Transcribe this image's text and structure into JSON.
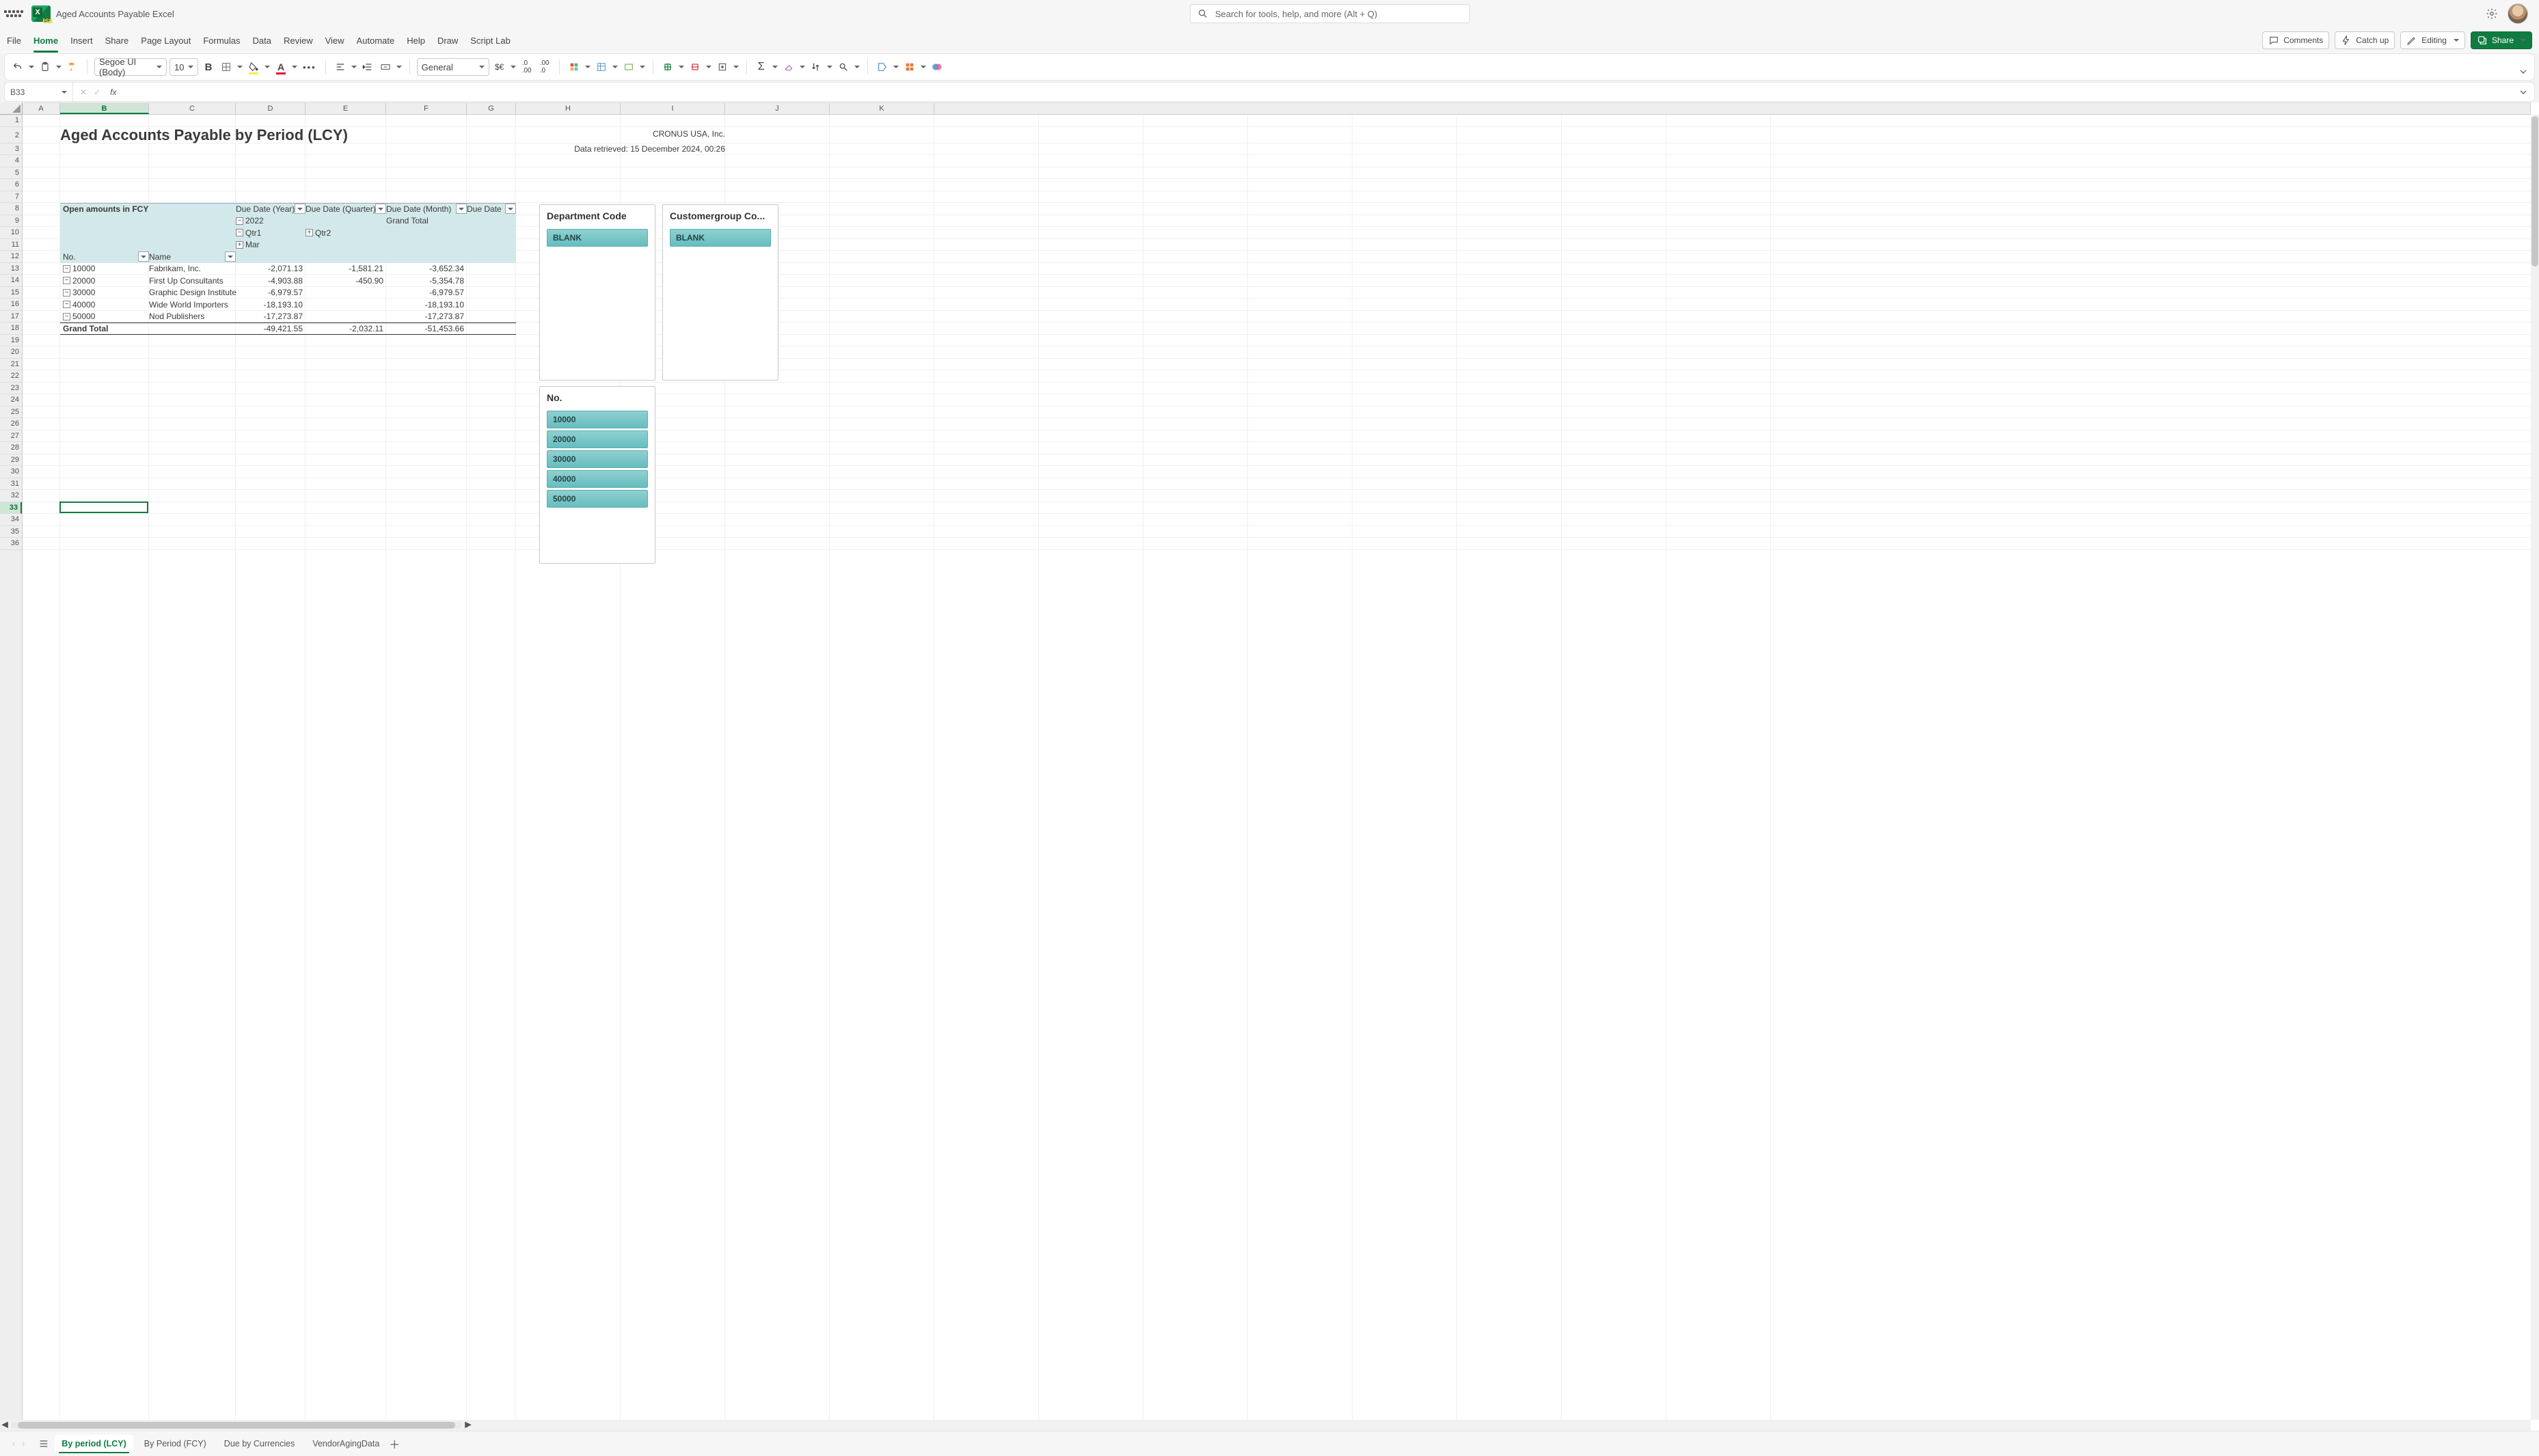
{
  "colors": {
    "accent": "#107c41",
    "slicer": "#7fcacc"
  },
  "title_bar": {
    "doc_title": "Aged Accounts Payable Excel",
    "search_placeholder": "Search for tools, help, and more (Alt + Q)"
  },
  "menu": {
    "tabs": [
      "File",
      "Home",
      "Insert",
      "Share",
      "Page Layout",
      "Formulas",
      "Data",
      "Review",
      "View",
      "Automate",
      "Help",
      "Draw",
      "Script Lab"
    ],
    "active": "Home",
    "right": {
      "comments": "Comments",
      "catch_up": "Catch up",
      "editing": "Editing",
      "share": "Share"
    }
  },
  "ribbon": {
    "font_name": "Segoe UI (Body)",
    "font_size": "10",
    "number_format": "General"
  },
  "formula_bar": {
    "name_box": "B33",
    "fx": ""
  },
  "columns": [
    {
      "label": "A",
      "width": 55
    },
    {
      "label": "B",
      "width": 130,
      "selected": true
    },
    {
      "label": "C",
      "width": 127
    },
    {
      "label": "D",
      "width": 102
    },
    {
      "label": "E",
      "width": 118
    },
    {
      "label": "F",
      "width": 118
    },
    {
      "label": "G",
      "width": 72
    },
    {
      "label": "H",
      "width": 153
    },
    {
      "label": "I",
      "width": 153
    },
    {
      "label": "J",
      "width": 153
    },
    {
      "label": "K",
      "width": 153
    }
  ],
  "row_count": 36,
  "tall_row_index": 2,
  "selected_row": 33,
  "report": {
    "title": "Aged Accounts Payable by Period (LCY)",
    "company": "CRONUS USA, Inc.",
    "retrieved": "Data retrieved: 15 December 2024, 00:26"
  },
  "pivot": {
    "header_left": "Open amounts in FCY",
    "col_headers": [
      "Due Date (Year)",
      "Due Date (Quarter)",
      "Due Date (Month)",
      "Due Date"
    ],
    "year": "2022",
    "quarters": [
      "Qtr1",
      "Qtr2"
    ],
    "month": "Mar",
    "grand_total_col": "Grand Total",
    "row_labels": [
      "No.",
      "Name"
    ],
    "rows": [
      {
        "no": "10000",
        "name": "Fabrikam, Inc.",
        "v1": "-2,071.13",
        "v2": "-1,581.21",
        "tot": "-3,652.34"
      },
      {
        "no": "20000",
        "name": "First Up Consultants",
        "v1": "-4,903.88",
        "v2": "-450.90",
        "tot": "-5,354.78"
      },
      {
        "no": "30000",
        "name": "Graphic Design Institute",
        "v1": "-6,979.57",
        "v2": "",
        "tot": "-6,979.57"
      },
      {
        "no": "40000",
        "name": "Wide World Importers",
        "v1": "-18,193.10",
        "v2": "",
        "tot": "-18,193.10"
      },
      {
        "no": "50000",
        "name": "Nod Publishers",
        "v1": "-17,273.87",
        "v2": "",
        "tot": "-17,273.87"
      }
    ],
    "grand_total_label": "Grand Total",
    "grand_totals": {
      "v1": "-49,421.55",
      "v2": "-2,032.11",
      "tot": "-51,453.66"
    }
  },
  "slicers": {
    "dept": {
      "title": "Department Code",
      "items": [
        "BLANK"
      ]
    },
    "cgroup": {
      "title": "Customergroup Co...",
      "items": [
        "BLANK"
      ]
    },
    "no": {
      "title": "No.",
      "items": [
        "10000",
        "20000",
        "30000",
        "40000",
        "50000"
      ]
    }
  },
  "sheet_tabs": {
    "tabs": [
      "By period (LCY)",
      "By Period (FCY)",
      "Due by Currencies",
      "VendorAgingData"
    ],
    "active": "By period (LCY)"
  }
}
